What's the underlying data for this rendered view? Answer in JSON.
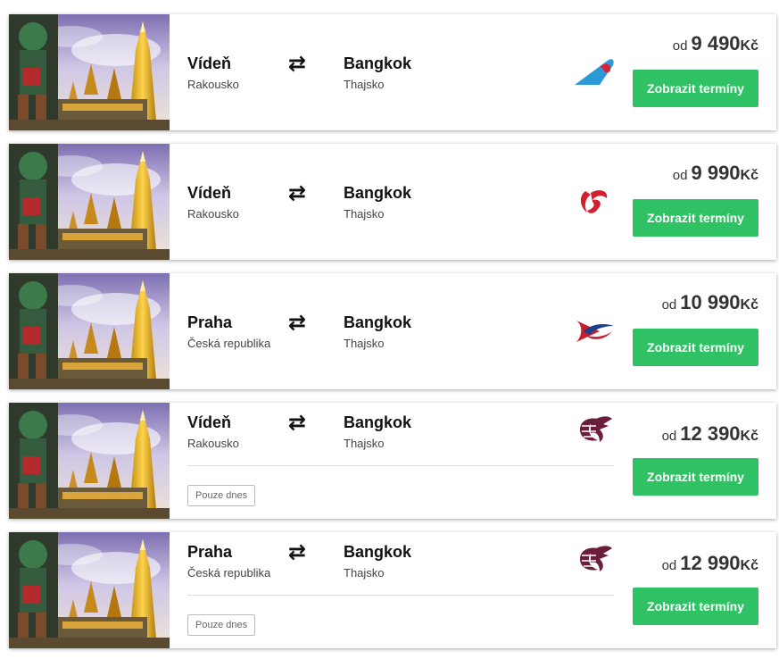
{
  "offers": [
    {
      "from_city": "Vídeň",
      "from_country": "Rakousko",
      "to_city": "Bangkok",
      "to_country": "Thajsko",
      "price_prefix": "od",
      "price": "9 490",
      "currency": "Kč",
      "button": "Zobrazit termíny",
      "airline_icon": "china-southern-logo-icon",
      "note": ""
    },
    {
      "from_city": "Vídeň",
      "from_country": "Rakousko",
      "to_city": "Bangkok",
      "to_country": "Thajsko",
      "price_prefix": "od",
      "price": "9 990",
      "currency": "Kč",
      "button": "Zobrazit termíny",
      "airline_icon": "air-china-logo-icon",
      "note": ""
    },
    {
      "from_city": "Praha",
      "from_country": "Česká republika",
      "to_city": "Bangkok",
      "to_country": "Thajsko",
      "price_prefix": "od",
      "price": "10 990",
      "currency": "Kč",
      "button": "Zobrazit termíny",
      "airline_icon": "china-eastern-logo-icon",
      "note": ""
    },
    {
      "from_city": "Vídeň",
      "from_country": "Rakousko",
      "to_city": "Bangkok",
      "to_country": "Thajsko",
      "price_prefix": "od",
      "price": "12 390",
      "currency": "Kč",
      "button": "Zobrazit termíny",
      "airline_icon": "qatar-airways-logo-icon",
      "note": "Pouze dnes"
    },
    {
      "from_city": "Praha",
      "from_country": "Česká republika",
      "to_city": "Bangkok",
      "to_country": "Thajsko",
      "price_prefix": "od",
      "price": "12 990",
      "currency": "Kč",
      "button": "Zobrazit termíny",
      "airline_icon": "qatar-airways-logo-icon",
      "note": "Pouze dnes"
    }
  ],
  "colors": {
    "button": "#2ec265",
    "button_text": "#ffffff",
    "price": "#333333",
    "country": "#444444"
  }
}
